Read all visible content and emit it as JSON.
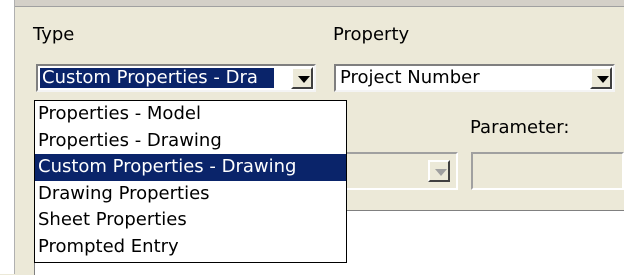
{
  "type_section": {
    "label": "Type",
    "selected_value": "Custom Properties - Dra",
    "options": [
      "Properties - Model",
      "Properties - Drawing",
      "Custom Properties - Drawing",
      "Drawing Properties",
      "Sheet Properties",
      "Prompted Entry"
    ],
    "highlighted_index": 2
  },
  "property_section": {
    "label": "Property",
    "selected_value": "Project Number"
  },
  "parameter_section": {
    "label": "Parameter:"
  },
  "colors": {
    "selection": "#0a246a",
    "dialog_bg": "#ece9d8"
  }
}
